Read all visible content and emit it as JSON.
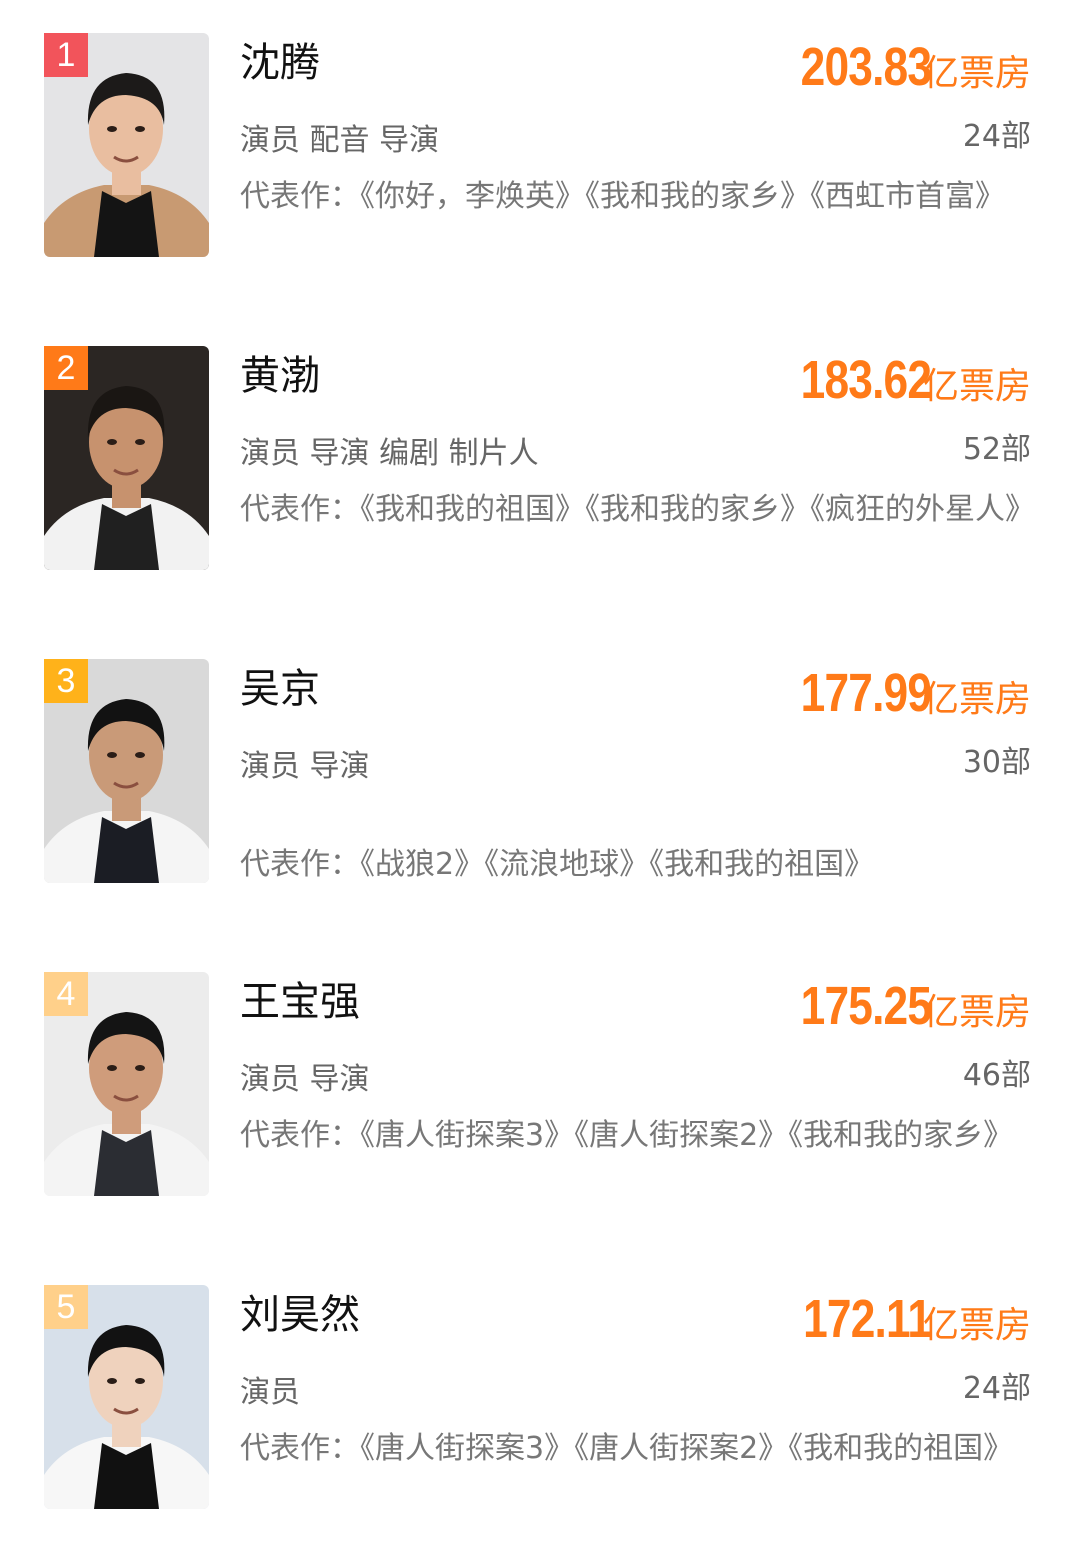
{
  "ranking": [
    {
      "rank": "1",
      "rank_color": "#f2545b",
      "name": "沈腾",
      "box_office": "203.83",
      "box_unit": "亿票房",
      "roles": "演员  配音  导演",
      "works": "24部",
      "representative": "代表作：《你好，李焕英》《我和我的家乡》《西虹市首富》",
      "photo": {
        "bg": "#e4e4e6",
        "skin": "#e9bea0",
        "hair": "#1c1a19",
        "clothes": "#141414",
        "jacket": "#c89a72"
      }
    },
    {
      "rank": "2",
      "rank_color": "#ff7a18",
      "name": "黄渤",
      "box_office": "183.62",
      "box_unit": "亿票房",
      "roles": "演员  导演  编剧  制片人",
      "works": "52部",
      "representative": "代表作：《我和我的祖国》《我和我的家乡》《疯狂的外星人》",
      "photo": {
        "bg": "#2b2623",
        "skin": "#c7926e",
        "hair": "#1a1613",
        "clothes": "#202020",
        "jacket": "#f2f2f2"
      }
    },
    {
      "rank": "3",
      "rank_color": "#ffb21a",
      "name": "吴京",
      "box_office": "177.99",
      "box_unit": "亿票房",
      "roles": "演员  导演",
      "works": "30部",
      "representative": "代表作：《战狼2》《流浪地球》《我和我的祖国》",
      "photo": {
        "bg": "#d9d9d9",
        "skin": "#c99a78",
        "hair": "#121212",
        "clothes": "#1b1d24",
        "jacket": "#f5f5f5"
      }
    },
    {
      "rank": "4",
      "rank_color": "#ffd08a",
      "name": "王宝强",
      "box_office": "175.25",
      "box_unit": "亿票房",
      "roles": "演员  导演",
      "works": "46部",
      "representative": "代表作：《唐人街探案3》《唐人街探案2》《我和我的家乡》",
      "photo": {
        "bg": "#ececec",
        "skin": "#cf9c7b",
        "hair": "#141414",
        "clothes": "#2b2d33",
        "jacket": "#f4f4f4"
      }
    },
    {
      "rank": "5",
      "rank_color": "#ffd08a",
      "name": "刘昊然",
      "box_office": "172.11",
      "box_unit": "亿票房",
      "roles": "演员",
      "works": "24部",
      "representative": "代表作：《唐人街探案3》《唐人街探案2》《我和我的祖国》",
      "photo": {
        "bg": "#d7e0ea",
        "skin": "#efd2bd",
        "hair": "#121212",
        "clothes": "#111111",
        "jacket": "#f7f7f7"
      }
    }
  ]
}
